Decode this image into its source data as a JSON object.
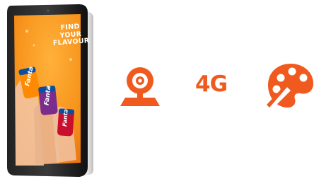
{
  "tablet": {
    "ad_headline": [
      "FIND",
      "YOUR",
      "FLAVOUR"
    ],
    "brand": "Fanta"
  },
  "features": {
    "webcam_icon": "webcam-icon",
    "network_label": "4G",
    "palette_icon": "palette-icon"
  },
  "colors": {
    "accent": "#f05a1e",
    "ad_background": "#f7941d"
  }
}
